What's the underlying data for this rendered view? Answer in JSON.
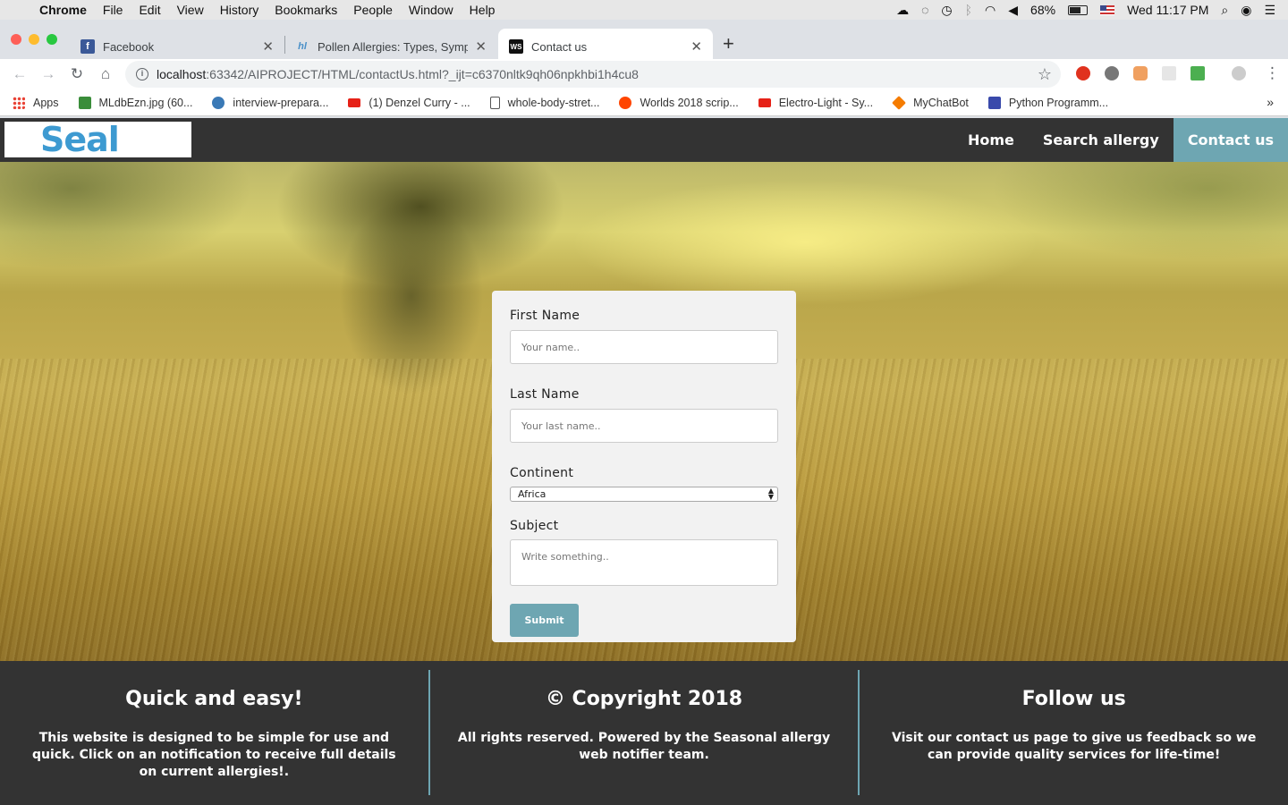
{
  "menubar": {
    "app": "Chrome",
    "items": [
      "File",
      "Edit",
      "View",
      "History",
      "Bookmarks",
      "People",
      "Window",
      "Help"
    ],
    "battery": "68%",
    "clock": "Wed 11:17 PM"
  },
  "tabs": [
    {
      "title": "Facebook",
      "icon": "facebook-icon"
    },
    {
      "title": "Pollen Allergies: Types, Sympto",
      "icon": "healthline-icon"
    },
    {
      "title": "Contact us",
      "icon": "webstorm-icon"
    }
  ],
  "toolbar": {
    "url_host": "localhost",
    "url_rest": ":63342/AIPROJECT/HTML/contactUs.html?_ijt=c6370nltk9qh06npkhbi1h4cu8"
  },
  "bookmarks": [
    {
      "label": "Apps",
      "color": "#e94235"
    },
    {
      "label": "MLdbEzn.jpg (60...",
      "color": "#3a8d3a"
    },
    {
      "label": "interview-prepara...",
      "color": "#3a79b6"
    },
    {
      "label": "(1) Denzel Curry - ...",
      "color": "#e62117"
    },
    {
      "label": "whole-body-stret...",
      "color": "#ffffff"
    },
    {
      "label": "Worlds 2018 scrip...",
      "color": "#ff4500"
    },
    {
      "label": "Electro-Light - Sy...",
      "color": "#e62117"
    },
    {
      "label": "MyChatBot",
      "color": "#f57c00"
    },
    {
      "label": "Python Programm...",
      "color": "#3949ab"
    }
  ],
  "site": {
    "logo": "Seal",
    "nav": {
      "home": "Home",
      "search": "Search allergy",
      "contact": "Contact us"
    },
    "form": {
      "first_name_label": "First Name",
      "first_name_placeholder": "Your name..",
      "last_name_label": "Last Name",
      "last_name_placeholder": "Your last name..",
      "continent_label": "Continent",
      "continent_value": "Africa",
      "subject_label": "Subject",
      "subject_placeholder": "Write something..",
      "submit": "Submit"
    },
    "footer": [
      {
        "title": "Quick and easy!",
        "text": "This website is designed to be simple for use and quick. Click on an notification to receive full details on current allergies!."
      },
      {
        "title": "© Copyright 2018",
        "text": "All rights reserved. Powered by the Seasonal allergy web notifier team."
      },
      {
        "title": "Follow us",
        "text": "Visit our contact us page to give us feedback so we can provide quality services for life-time!"
      }
    ]
  },
  "colors": {
    "accent": "#6ea6b2",
    "nav_bg": "#333333",
    "logo": "#3d9ad1"
  }
}
